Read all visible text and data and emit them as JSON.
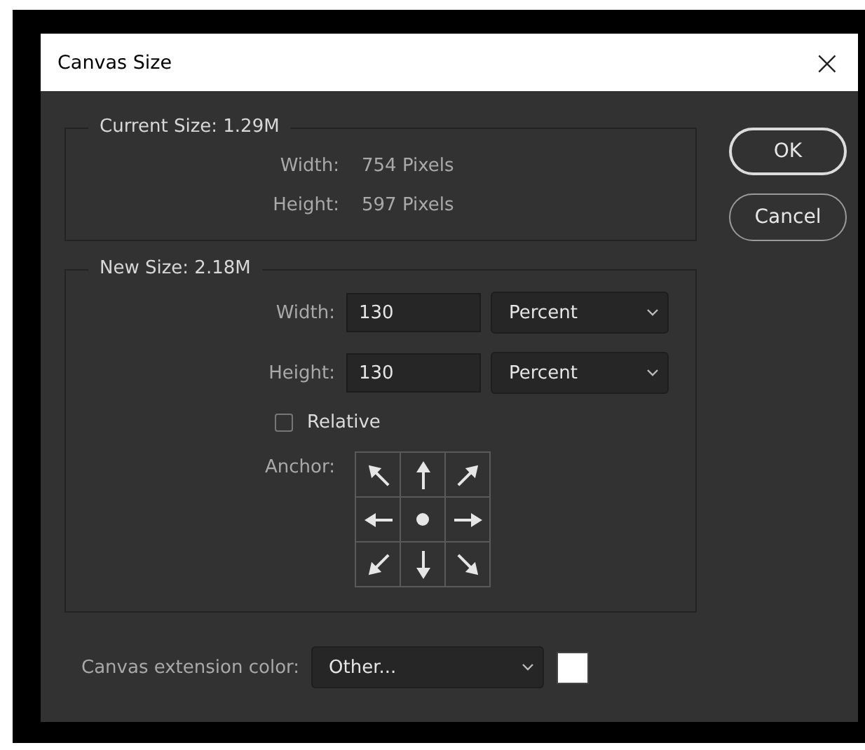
{
  "window": {
    "title": "Canvas Size",
    "close": "×"
  },
  "current_size": {
    "legend": "Current Size: 1.29M",
    "rows": [
      {
        "label": "Width:",
        "value": "754 Pixels"
      },
      {
        "label": "Height:",
        "value": "597 Pixels"
      }
    ]
  },
  "new_size": {
    "legend": "New Size: 2.18M",
    "rows": [
      {
        "label": "Width:",
        "value": "130",
        "unit": "Percent"
      },
      {
        "label": "Height:",
        "value": "130",
        "unit": "Percent"
      }
    ],
    "relative": {
      "label": "Relative",
      "checked": false
    },
    "anchor": {
      "label": "Anchor:",
      "cells": [
        {
          "selected": false
        },
        {
          "selected": false
        },
        {
          "selected": false
        },
        {
          "selected": false
        },
        {
          "selected": true
        },
        {
          "selected": false
        },
        {
          "selected": false
        },
        {
          "selected": false
        },
        {
          "selected": false
        }
      ]
    }
  },
  "extension": {
    "label": "Canvas extension color:",
    "value": "Other...",
    "color": "#ffffff"
  },
  "buttons": [
    {
      "label": "OK",
      "default": true
    },
    {
      "label": "Cancel",
      "default": false
    }
  ]
}
